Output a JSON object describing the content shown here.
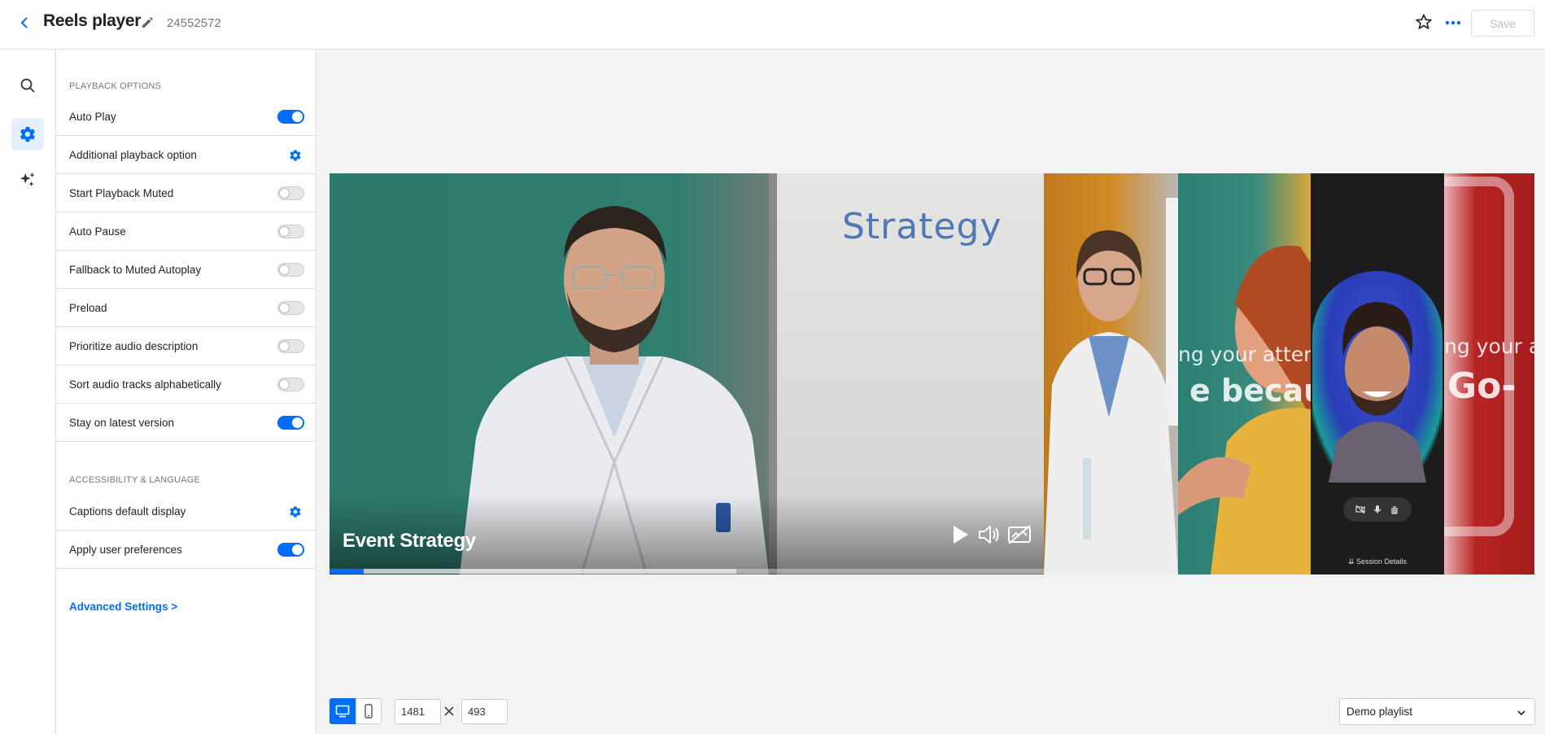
{
  "header": {
    "title": "Reels player",
    "player_id": "24552572",
    "save_label": "Save"
  },
  "sections": {
    "playback_title": "PLAYBACK OPTIONS",
    "accessibility_title": "ACCESSIBILITY & LANGUAGE"
  },
  "playback_options": [
    {
      "label": "Auto Play",
      "control": "toggle",
      "on": true
    },
    {
      "label": "Additional playback option",
      "control": "gear"
    },
    {
      "label": "Start Playback Muted",
      "control": "toggle",
      "on": false
    },
    {
      "label": "Auto Pause",
      "control": "toggle",
      "on": false
    },
    {
      "label": "Fallback to Muted Autoplay",
      "control": "toggle",
      "on": false
    },
    {
      "label": "Preload",
      "control": "toggle",
      "on": false
    },
    {
      "label": "Prioritize audio description",
      "control": "toggle",
      "on": false
    },
    {
      "label": "Sort audio tracks alphabetically",
      "control": "toggle",
      "on": false
    },
    {
      "label": "Stay on latest version",
      "control": "toggle",
      "on": true
    }
  ],
  "accessibility_options": [
    {
      "label": "Captions default display",
      "control": "gear"
    },
    {
      "label": "Apply user preferences",
      "control": "toggle",
      "on": true
    }
  ],
  "advanced_link": "Advanced Settings >",
  "preview": {
    "video_title": "Event Strategy",
    "board_word": "Strategy",
    "progress": 0.048,
    "side_text_1": "ng your atten",
    "side_text_2": "e because",
    "side_text_3": "ng your a",
    "side_text_4": "Go-",
    "session_details": "Session Details"
  },
  "dimensions": {
    "width": "1481",
    "height": "493"
  },
  "playlist": {
    "selected": "Demo playlist"
  },
  "colors": {
    "accent": "#006efa"
  }
}
